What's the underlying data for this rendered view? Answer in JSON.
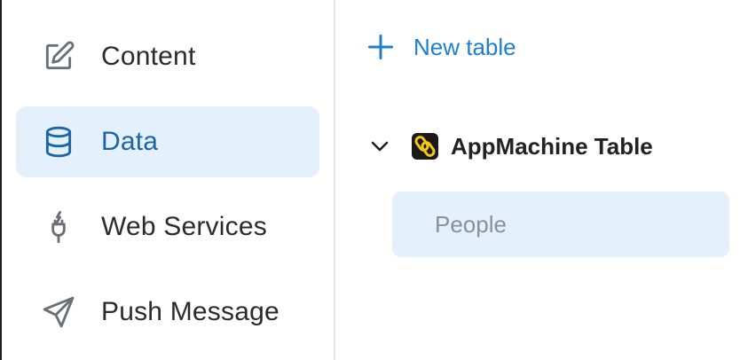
{
  "sidebar": {
    "items": [
      {
        "label": "Content",
        "icon": "edit-icon",
        "active": false
      },
      {
        "label": "Data",
        "icon": "database-icon",
        "active": true
      },
      {
        "label": "Web Services",
        "icon": "plug-icon",
        "active": false
      },
      {
        "label": "Push Message",
        "icon": "send-icon",
        "active": false
      }
    ]
  },
  "main": {
    "new_table_label": "New table",
    "group": {
      "title": "AppMachine Table",
      "expanded": true,
      "tables": [
        {
          "label": "People",
          "selected": true
        }
      ]
    }
  },
  "colors": {
    "accent": "#1e7fcf",
    "active_bg": "#e4f1fc",
    "active_text": "#1b65a6",
    "logo_yellow": "#f5c518"
  }
}
